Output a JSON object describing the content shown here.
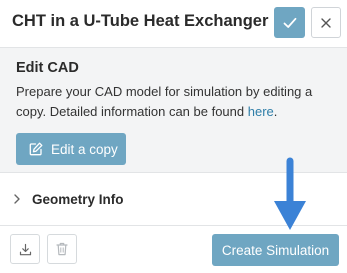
{
  "header": {
    "title": "CHT in a U-Tube Heat Exchanger",
    "confirm_icon": "check-icon",
    "close_icon": "close-icon"
  },
  "edit_cad": {
    "title": "Edit CAD",
    "description_before_link": "Prepare your CAD model for simulation by editing a copy. Detailed information can be found ",
    "link_text": "here",
    "description_after_link": ".",
    "button_label": "Edit a copy",
    "button_icon": "edit-icon"
  },
  "geometry_info": {
    "label": "Geometry Info",
    "icon": "chevron-right-icon"
  },
  "footer": {
    "download_icon": "download-icon",
    "delete_icon": "trash-icon",
    "create_label": "Create Simulation"
  },
  "colors": {
    "accent": "#6fa6c2",
    "link": "#2f7ea8",
    "section_bg": "#f3f4f5",
    "annotation_arrow": "#3b82d6"
  }
}
